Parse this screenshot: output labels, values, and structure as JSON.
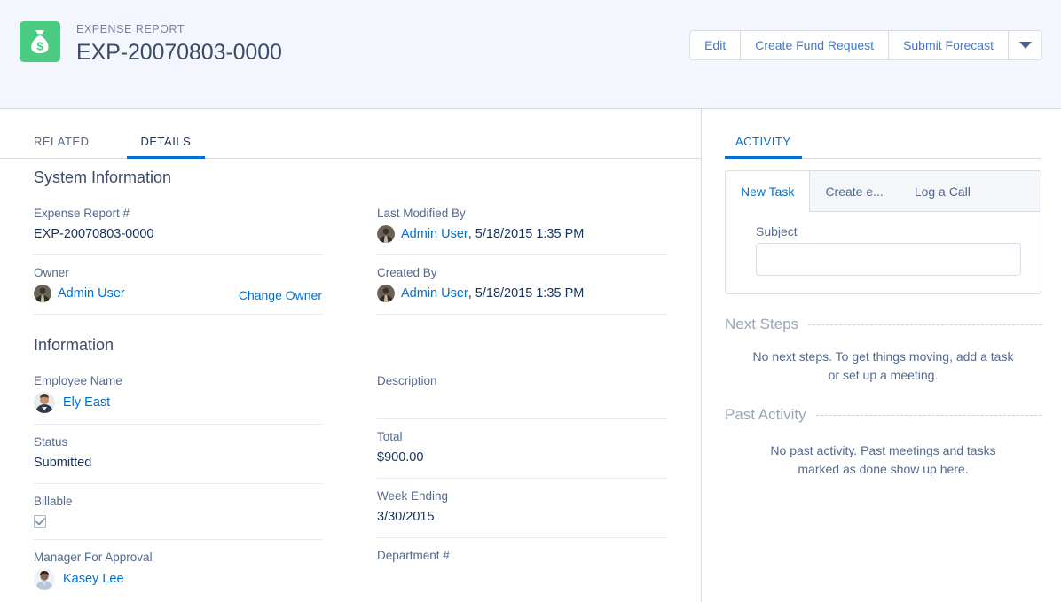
{
  "header": {
    "object_icon": "money-bag-icon",
    "eyebrow": "EXPENSE REPORT",
    "record_name": "EXP-20070803-0000",
    "accent_green": "#4bca81",
    "actions": [
      {
        "label": "Edit",
        "name": "edit-button"
      },
      {
        "label": "Create Fund Request",
        "name": "create-fund-request-button"
      },
      {
        "label": "Submit Forecast",
        "name": "submit-forecast-button"
      }
    ],
    "more_actions_icon": "chevron-down-icon"
  },
  "tabs": [
    {
      "label": "RELATED",
      "active": false
    },
    {
      "label": "DETAILS",
      "active": true
    }
  ],
  "system_information": {
    "title": "System Information",
    "left": [
      {
        "label": "Expense Report #",
        "value": "EXP-20070803-0000",
        "type": "text"
      },
      {
        "label": "Owner",
        "value": "Admin User",
        "type": "user",
        "action_label": "Change Owner"
      }
    ],
    "right": [
      {
        "label": "Last Modified By",
        "value": "Admin User",
        "suffix": ", 5/18/2015 1:35 PM",
        "type": "user"
      },
      {
        "label": "Created By",
        "value": "Admin User",
        "suffix": ", 5/18/2015 1:35 PM",
        "type": "user"
      }
    ]
  },
  "information": {
    "title": "Information",
    "left": [
      {
        "label": "Employee Name",
        "value": "Ely East",
        "type": "user"
      },
      {
        "label": "Status",
        "value": "Submitted",
        "type": "text"
      },
      {
        "label": "Billable",
        "value": "",
        "type": "checkbox",
        "checked": true
      },
      {
        "label": "Manager For Approval",
        "value": "Kasey Lee",
        "type": "user"
      }
    ],
    "right": [
      {
        "label": "Description",
        "value": "",
        "type": "text"
      },
      {
        "label": "Total",
        "value": "$900.00",
        "type": "text"
      },
      {
        "label": "Week Ending",
        "value": "3/30/2015",
        "type": "text"
      },
      {
        "label": "Department #",
        "value": "",
        "type": "text"
      }
    ]
  },
  "activity": {
    "tab_label": "ACTIVITY",
    "publisher_tabs": [
      {
        "label": "New Task",
        "active": true
      },
      {
        "label": "Create e...",
        "active": false
      },
      {
        "label": "Log a Call",
        "active": false
      }
    ],
    "subject_label": "Subject",
    "subject_value": "",
    "subject_placeholder": "",
    "next_steps": {
      "title": "Next Steps",
      "empty_message": "No next steps. To get things moving, add a task or set up a meeting."
    },
    "past_activity": {
      "title": "Past Activity",
      "empty_message": "No past activity. Past meetings and tasks marked as done show up here."
    }
  }
}
